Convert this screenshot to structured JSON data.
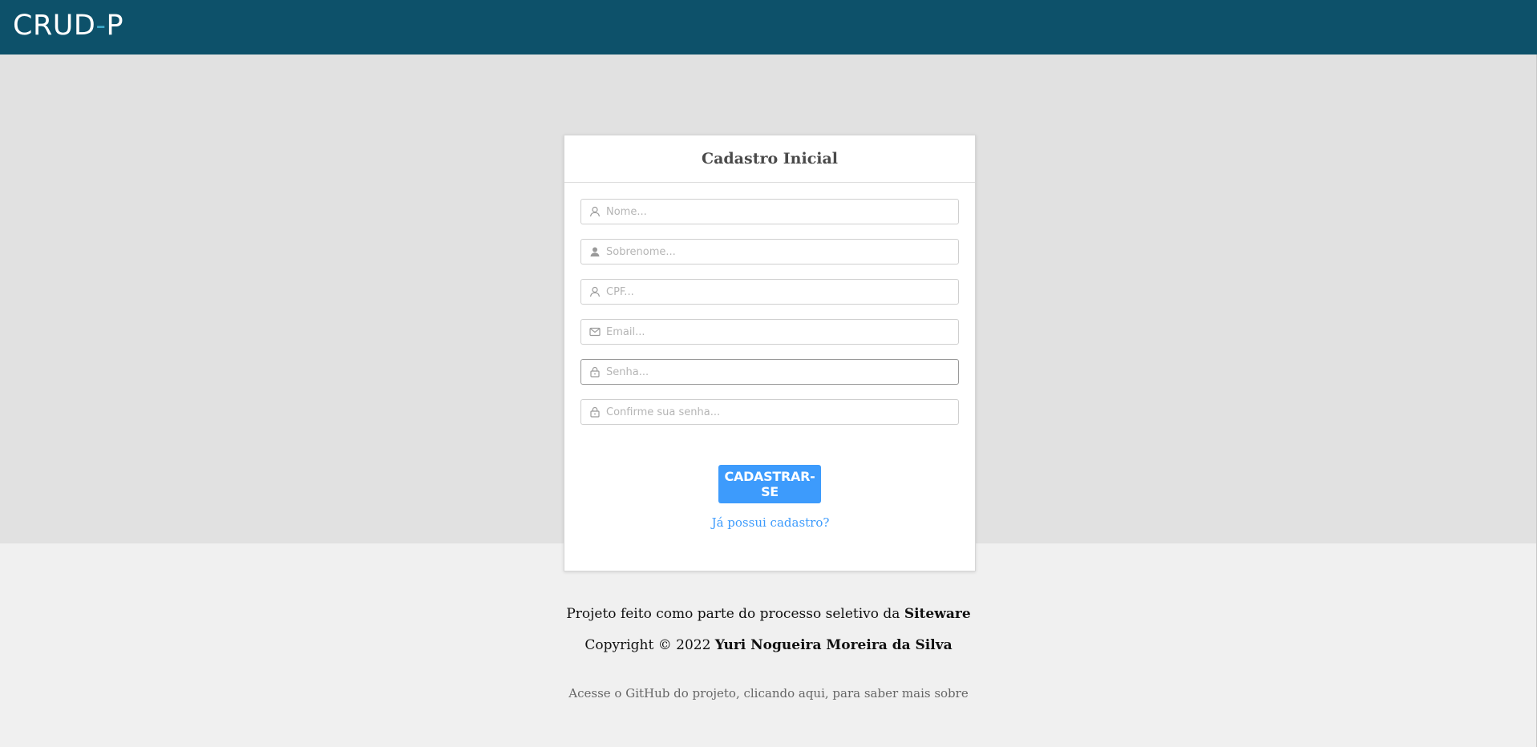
{
  "header": {
    "brand_left": "CRUD",
    "brand_dash": "-",
    "brand_right": "P"
  },
  "form": {
    "title": "Cadastro Inicial",
    "fields": [
      {
        "placeholder": "Nome...",
        "icon": "user-outline-icon",
        "value": ""
      },
      {
        "placeholder": "Sobrenome...",
        "icon": "user-filled-icon",
        "value": ""
      },
      {
        "placeholder": "CPF...",
        "icon": "user-outline-icon",
        "value": ""
      },
      {
        "placeholder": "Email...",
        "icon": "envelope-icon",
        "value": ""
      },
      {
        "placeholder": "Senha...",
        "icon": "lock-icon",
        "value": ""
      },
      {
        "placeholder": "Confirme sua senha...",
        "icon": "lock-icon",
        "value": ""
      }
    ],
    "submit_label": "CADASTRAR-SE",
    "login_link": "Já possui cadastro?"
  },
  "footer": {
    "line1_prefix": "Projeto feito como parte do processo seletivo da ",
    "line1_company": "Siteware",
    "line2_prefix": "Copyright © 2022 ",
    "line2_author": "Yuri Nogueira Moreira da Silva",
    "line3": "Acesse o GitHub do projeto, clicando aqui, para saber mais sobre"
  },
  "colors": {
    "topbar": "#0d516a",
    "accent": "#3d9bfc",
    "content_bg": "#e1e1e1",
    "footer_bg": "#f0f0f0"
  }
}
